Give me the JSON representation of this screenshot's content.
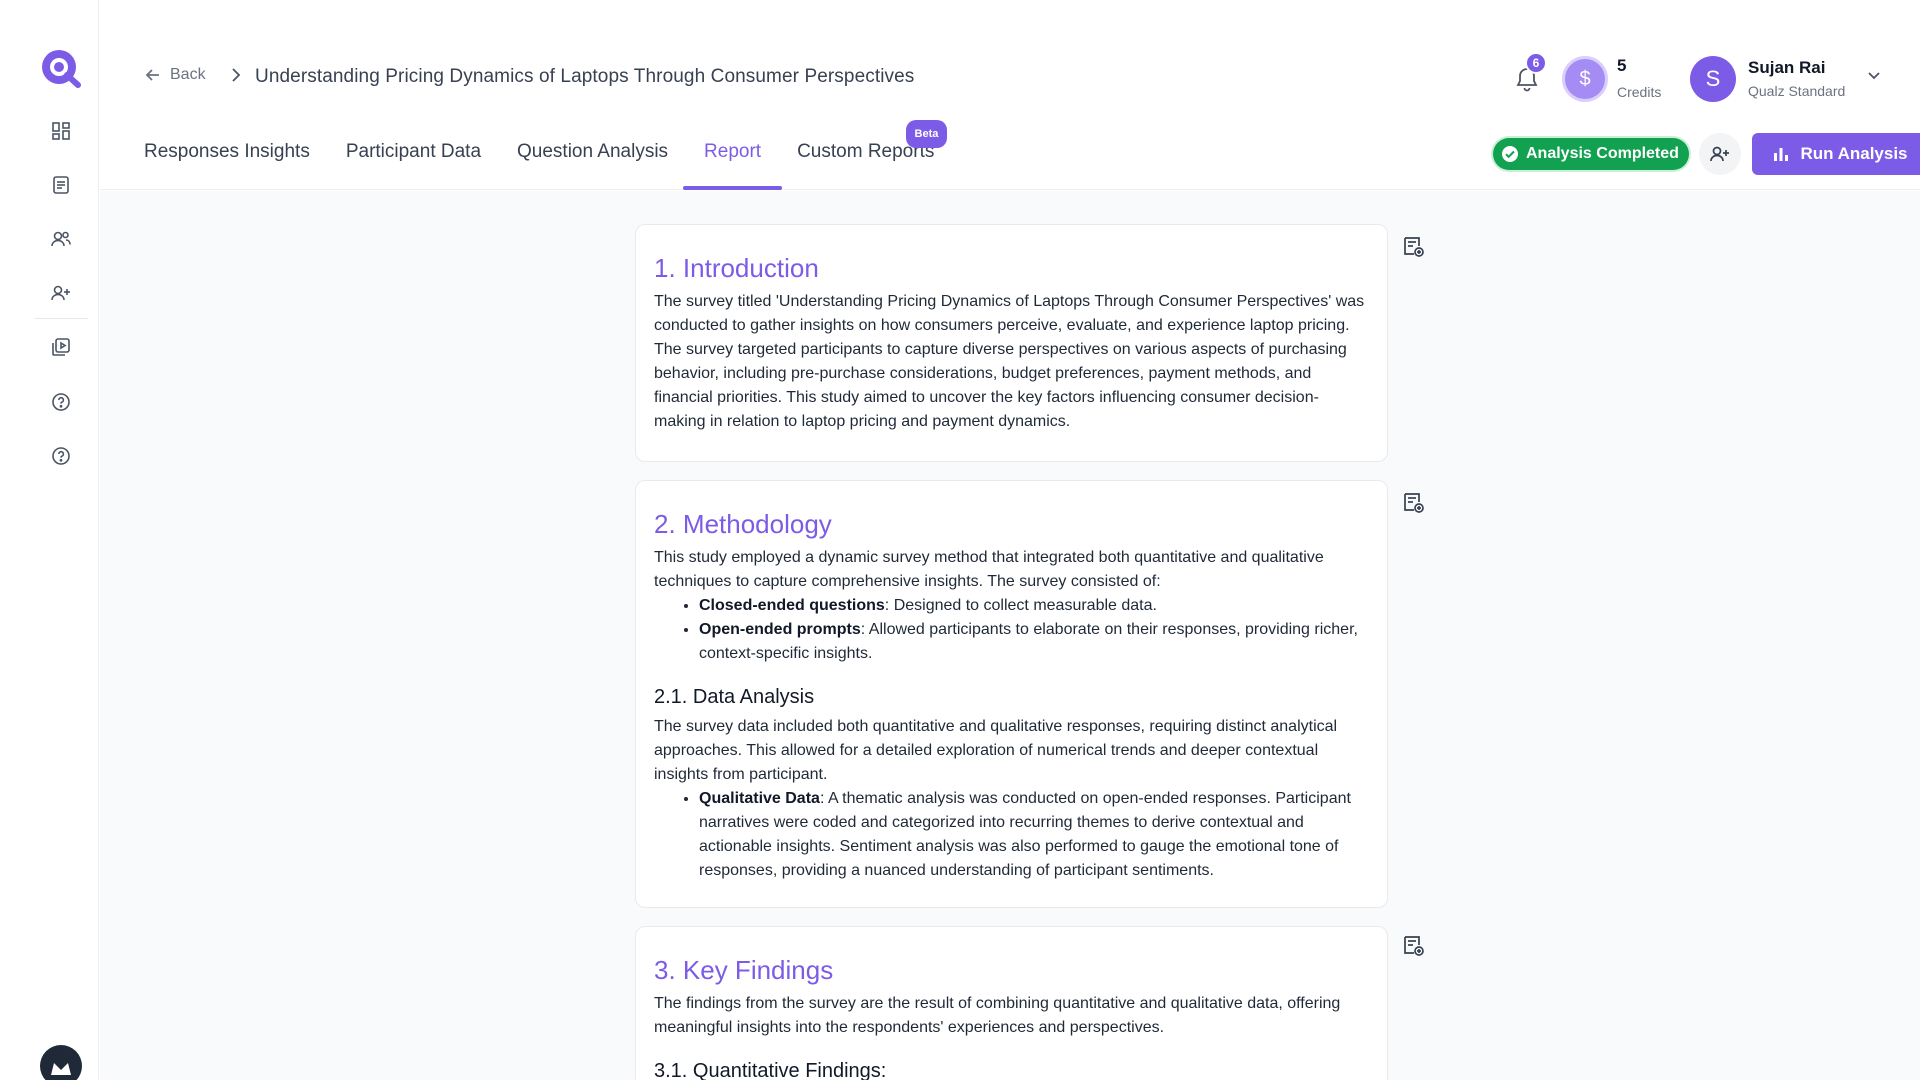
{
  "header": {
    "back_label": "Back",
    "title": "Understanding Pricing Dynamics of Laptops Through Consumer Perspectives",
    "notification_count": "6",
    "credits_value": "5",
    "credits_label": "Credits",
    "user_initial": "S",
    "user_name": "Sujan Rai",
    "user_plan": "Qualz Standard"
  },
  "tabs": [
    {
      "label": "Responses Insights"
    },
    {
      "label": "Participant Data"
    },
    {
      "label": "Question Analysis"
    },
    {
      "label": "Report"
    },
    {
      "label": "Custom Reports",
      "badge": "Beta"
    }
  ],
  "active_tab": "Report",
  "actions": {
    "status": "Analysis Completed",
    "run_label": "Run Analysis"
  },
  "colors": {
    "accent": "#7c5ce6",
    "success": "#12a150"
  },
  "sections": {
    "intro": {
      "heading": "1. Introduction",
      "body": "The survey titled 'Understanding Pricing Dynamics of Laptops Through Consumer Perspectives' was conducted to gather insights on how consumers perceive, evaluate, and experience laptop pricing. The survey targeted participants to capture diverse perspectives on various aspects of purchasing behavior, including pre-purchase considerations, budget preferences, payment methods, and financial priorities. This study aimed to uncover the key factors influencing consumer decision-making in relation to laptop pricing and payment dynamics."
    },
    "methodology": {
      "heading": "2. Methodology",
      "body": "This study employed a dynamic survey method that integrated both quantitative and qualitative techniques to capture comprehensive insights. The survey consisted of:",
      "items": [
        {
          "term": "Closed-ended questions",
          "text": ": Designed to collect measurable data."
        },
        {
          "term": "Open-ended prompts",
          "text": ": Allowed participants to elaborate on their responses, providing richer, context-specific insights."
        }
      ],
      "sub_heading": "2.1. Data Analysis",
      "sub_body": "The survey data included both quantitative and qualitative responses, requiring distinct analytical approaches. This allowed for a detailed exploration of numerical trends and deeper contextual insights from participant.",
      "sub_items": [
        {
          "term": "Qualitative Data",
          "text": ": A thematic analysis was conducted on open-ended responses. Participant narratives were coded and categorized into recurring themes to derive contextual and actionable insights. Sentiment analysis was also performed to gauge the emotional tone of responses, providing a nuanced understanding of participant sentiments."
        }
      ]
    },
    "findings": {
      "heading": "3. Key Findings",
      "body": "The findings from the survey are the result of combining quantitative and qualitative data, offering meaningful insights into the respondents' experiences and perspectives.",
      "sub_heading": "3.1. Quantitative Findings:"
    }
  },
  "icons": {
    "logo": "qualz-logo",
    "sidebar": [
      "dashboard-icon",
      "document-icon",
      "users-icon",
      "add-user-icon",
      "media-library-icon",
      "help-icon",
      "support-icon"
    ],
    "notes": "note-add-icon"
  }
}
